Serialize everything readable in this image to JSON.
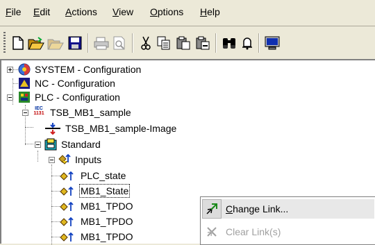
{
  "menubar": {
    "items": [
      {
        "label": "File",
        "key": "F"
      },
      {
        "label": "Edit",
        "key": "E"
      },
      {
        "label": "Actions",
        "key": "A"
      },
      {
        "label": "View",
        "key": "V"
      },
      {
        "label": "Options",
        "key": "O"
      },
      {
        "label": "Help",
        "key": "H"
      }
    ]
  },
  "toolbar": {
    "buttons": [
      "new-file-icon",
      "open-folder-icon",
      "open-folder-disabled-icon",
      "save-icon",
      "print-icon",
      "print-preview-icon",
      "cut-icon",
      "copy-icon",
      "paste-icon",
      "paste-special-icon",
      "find-icon",
      "bell-icon",
      "monitor-icon"
    ]
  },
  "tree": {
    "system": "SYSTEM - Configuration",
    "nc": "NC - Configuration",
    "plc": "PLC - Configuration",
    "project": "TSB_MB1_sample",
    "iec_top": "IEC",
    "iec_bottom": "1131",
    "image": "TSB_MB1_sample-Image",
    "standard": "Standard",
    "inputs": "Inputs",
    "plc_state": "PLC_state",
    "mb1_state": "MB1_State",
    "tpdo1": "MB1_TPDO",
    "tpdo2": "MB1_TPDO",
    "tpdo3": "MB1_TPDO"
  },
  "context_menu": {
    "change_link": "Change Link...",
    "change_link_key": "C",
    "clear_link": "Clear Link(s)"
  }
}
